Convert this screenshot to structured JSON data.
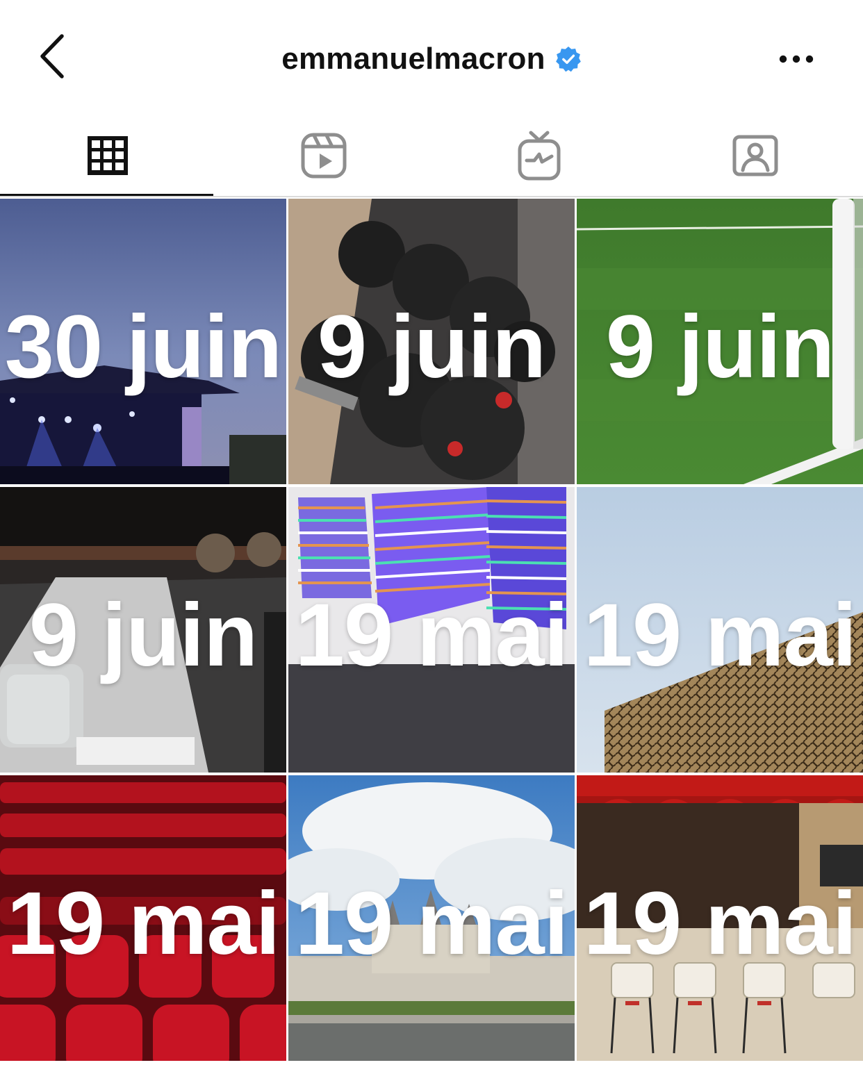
{
  "header": {
    "title": "emmanuelmacron",
    "verified": true
  },
  "tabs": [
    {
      "name": "grid-icon",
      "active": true
    },
    {
      "name": "reels-icon",
      "active": false
    },
    {
      "name": "igtv-icon",
      "active": false
    },
    {
      "name": "tagged-icon",
      "active": false
    }
  ],
  "colors": {
    "verified": "#3897f0",
    "icon_gray": "#8e8e8e",
    "text": "#111111"
  },
  "posts": [
    {
      "label": "30 juin",
      "scene": "concert-stage"
    },
    {
      "label": "9 juin",
      "scene": "dumbbells"
    },
    {
      "label": "9 juin",
      "scene": "football-pitch"
    },
    {
      "label": "9 juin",
      "scene": "restaurant-tables"
    },
    {
      "label": "19 mai",
      "scene": "art-gallery"
    },
    {
      "label": "19 mai",
      "scene": "mucem-building"
    },
    {
      "label": "19 mai",
      "scene": "cinema-seats"
    },
    {
      "label": "19 mai",
      "scene": "chambord-castle"
    },
    {
      "label": "19 mai",
      "scene": "cafe-terrace"
    }
  ]
}
